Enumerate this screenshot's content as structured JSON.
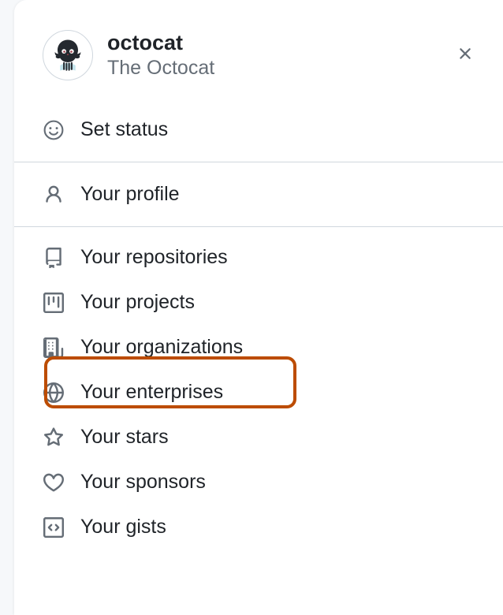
{
  "user": {
    "username": "octocat",
    "fullname": "The Octocat"
  },
  "menu": {
    "set_status": "Set status",
    "profile": "Your profile",
    "repositories": "Your repositories",
    "projects": "Your projects",
    "organizations": "Your organizations",
    "enterprises": "Your enterprises",
    "stars": "Your stars",
    "sponsors": "Your sponsors",
    "gists": "Your gists"
  }
}
